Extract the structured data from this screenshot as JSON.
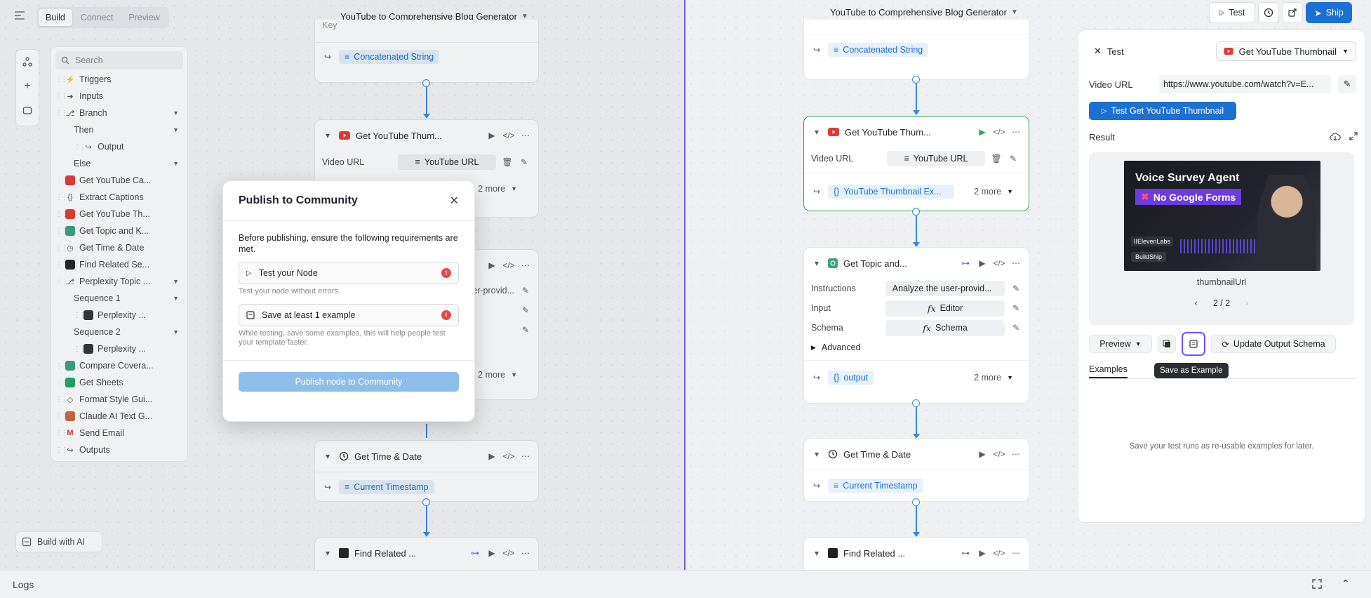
{
  "left": {
    "modes": [
      "Build",
      "Connect",
      "Preview"
    ],
    "title": "YouTube to Comprehensive Blog Generator",
    "search_placeholder": "Search",
    "tree": [
      {
        "label": "Triggers",
        "icon": "lightning-icon",
        "indent": 0
      },
      {
        "label": "Inputs",
        "icon": "login-icon",
        "indent": 0
      },
      {
        "label": "Branch",
        "icon": "branch-icon",
        "indent": 0,
        "caret": true
      },
      {
        "label": "Then",
        "indent": 1,
        "caret": true
      },
      {
        "label": "Output",
        "icon": "output-icon",
        "indent": 2
      },
      {
        "label": "Else",
        "indent": 1,
        "caret": true
      },
      {
        "label": "Get YouTube Ca...",
        "icon": "youtube-icon",
        "indent": 0
      },
      {
        "label": "Extract Captions",
        "icon": "braces-icon",
        "indent": 0
      },
      {
        "label": "Get YouTube Th...",
        "icon": "youtube-icon",
        "indent": 0
      },
      {
        "label": "Get Topic and K...",
        "icon": "openai-icon",
        "indent": 0
      },
      {
        "label": "Get Time & Date",
        "icon": "clock-icon",
        "indent": 0
      },
      {
        "label": "Find Related Se...",
        "icon": "search-node-icon",
        "indent": 0
      },
      {
        "label": "Perplexity Topic ...",
        "icon": "branch-icon",
        "indent": 0,
        "caret": true
      },
      {
        "label": "Sequence 1",
        "indent": 1,
        "caret": true
      },
      {
        "label": "Perplexity ...",
        "icon": "perplexity-icon",
        "indent": 2
      },
      {
        "label": "Sequence 2",
        "indent": 1,
        "caret": true
      },
      {
        "label": "Perplexity ...",
        "icon": "perplexity-icon",
        "indent": 2
      },
      {
        "label": "Compare Covera...",
        "icon": "openai-icon",
        "indent": 0
      },
      {
        "label": "Get Sheets",
        "icon": "sheets-icon",
        "indent": 0
      },
      {
        "label": "Format Style Gui...",
        "icon": "format-icon",
        "indent": 0
      },
      {
        "label": "Claude AI Text G...",
        "icon": "claude-icon",
        "indent": 0
      },
      {
        "label": "Send Email",
        "icon": "gmail-icon",
        "indent": 0
      },
      {
        "label": "Outputs",
        "icon": "logout-icon",
        "indent": 0
      }
    ],
    "build_ai": "Build with AI",
    "canvas": {
      "concat": "Concatenated String",
      "yt_node": "Get YouTube Thum...",
      "video_url": "Video URL",
      "youtube_url": "YouTube URL",
      "more": "2 more",
      "more2": "2 more",
      "provid": "Analyze the user-provid...",
      "time_node": "Get Time & Date",
      "timestamp": "Current Timestamp",
      "find_node": "Find Related ..."
    },
    "key_label": "Key"
  },
  "modal": {
    "title": "Publish to Community",
    "intro": "Before publishing, ensure the following requirements are met.",
    "req1": "Test your Node",
    "req1_help": "Test your node without errors.",
    "req2": "Save at least 1 example",
    "req2_help": "While testing, save some examples, this will help people test your template faster.",
    "publish_btn": "Publish node to Community"
  },
  "right": {
    "title": "YouTube to Comprehensive Blog Generator",
    "test_btn": "Test",
    "ship_btn": "Ship",
    "canvas": {
      "concat": "Concatenated String",
      "yt_node": "Get YouTube Thum...",
      "video_url": "Video URL",
      "youtube_url": "YouTube URL",
      "thumb_output": "YouTube Thumbnail Ex...",
      "more1": "2 more",
      "topic_node": "Get Topic and...",
      "instructions": "Instructions",
      "instructions_val": "Analyze the user-provid...",
      "input": "Input",
      "input_val": "Editor",
      "schema": "Schema",
      "schema_val": "Schema",
      "advanced": "Advanced",
      "output": "output",
      "more2": "2 more",
      "time_node": "Get Time & Date",
      "timestamp": "Current Timestamp",
      "find_node": "Find Related ..."
    },
    "panel": {
      "close_label": "Test",
      "node_select": "Get YouTube Thumbnail",
      "video_url_label": "Video URL",
      "video_url_value": "https://www.youtube.com/watch?v=E...",
      "test_btn": "Test Get YouTube Thumbnail",
      "result_label": "Result",
      "thumb_title": "Voice Survey Agent",
      "thumb_badge": "No Google Forms",
      "thumb_brand1": "IIElevenLabs",
      "thumb_brand2": "BuildShip",
      "result_key": "thumbnailUrl",
      "pager": "2 / 2",
      "preview_btn": "Preview",
      "update_schema": "Update Output Schema",
      "tooltip": "Save as Example",
      "examples_tab": "Examples",
      "empty_text": "Save your test runs as re-usable examples for later."
    }
  },
  "logs": {
    "label": "Logs"
  }
}
